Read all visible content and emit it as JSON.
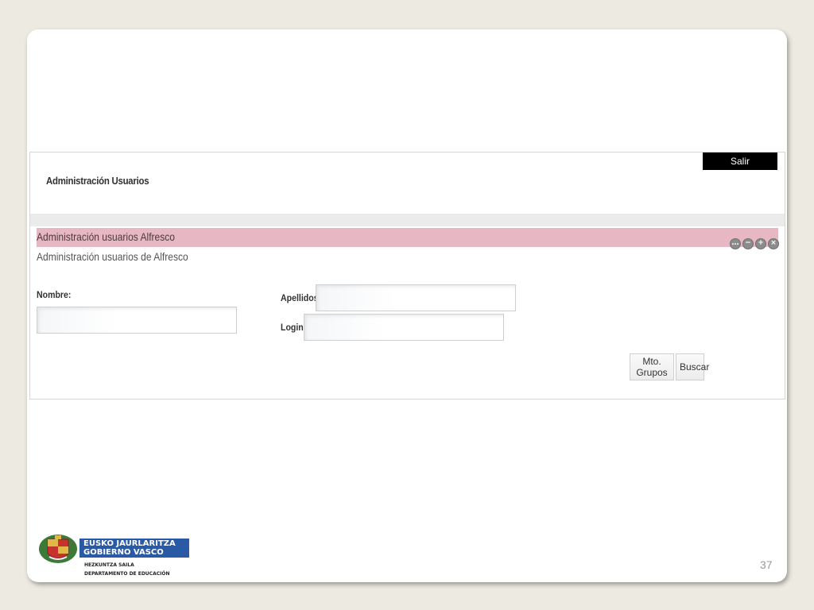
{
  "header": {
    "title": "Administración Usuarios",
    "logout_label": "Salir"
  },
  "portlet": {
    "title": "Administración usuarios Alfresco",
    "subtitle": "Administración usuarios de Alfresco",
    "icons": [
      "more-icon",
      "minimize-icon",
      "maximize-icon",
      "close-icon"
    ]
  },
  "form": {
    "nombre_label": "Nombre:",
    "nombre_value": "",
    "apellidos_label": "Apellidos:",
    "apellidos_value": "",
    "login_label": "Login:",
    "login_value": "",
    "groups_button": "Mto. Grupos",
    "search_button": "Buscar"
  },
  "footer": {
    "logo_line1": "EUSKO JAURLARITZA",
    "logo_line2": "GOBIERNO VASCO",
    "dept_eu": "HEZKUNTZA SAILA",
    "dept_es": "DEPARTAMENTO DE EDUCACIÓN",
    "page_number": "37"
  },
  "colors": {
    "portlet_title_bar": "#e8b7c4",
    "logo_blue": "#2a5aa6",
    "logout_bg": "#000000"
  }
}
